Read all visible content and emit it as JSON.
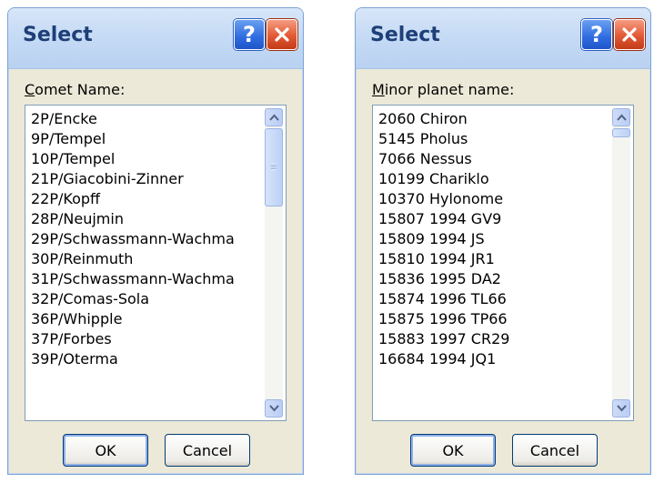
{
  "dialogs": [
    {
      "title": "Select",
      "label_access_key": "C",
      "label_rest": "omet Name:",
      "items": [
        "2P/Encke",
        "9P/Tempel",
        "10P/Tempel",
        "21P/Giacobini-Zinner",
        "22P/Kopff",
        "28P/Neujmin",
        "29P/Schwassmann-Wachma",
        "30P/Reinmuth",
        "31P/Schwassmann-Wachma",
        "32P/Comas-Sola",
        "36P/Whipple",
        "37P/Forbes",
        "39P/Oterma"
      ],
      "ok_label": "OK",
      "cancel_label": "Cancel"
    },
    {
      "title": "Select",
      "label_access_key": "M",
      "label_rest": "inor planet name:",
      "items": [
        "2060 Chiron",
        "5145 Pholus",
        "7066 Nessus",
        "10199 Chariklo",
        "10370 Hylonome",
        "15807 1994 GV9",
        "15809 1994 JS",
        "15810 1994 JR1",
        "15836 1995 DA2",
        "15874 1996 TL66",
        "15875 1996 TP66",
        "15883 1997 CR29",
        "16684 1994 JQ1"
      ],
      "ok_label": "OK",
      "cancel_label": "Cancel"
    }
  ],
  "icons": {
    "help": "question-mark-icon",
    "close": "close-x-icon",
    "scroll_up": "chevron-up-icon",
    "scroll_down": "chevron-down-icon"
  }
}
